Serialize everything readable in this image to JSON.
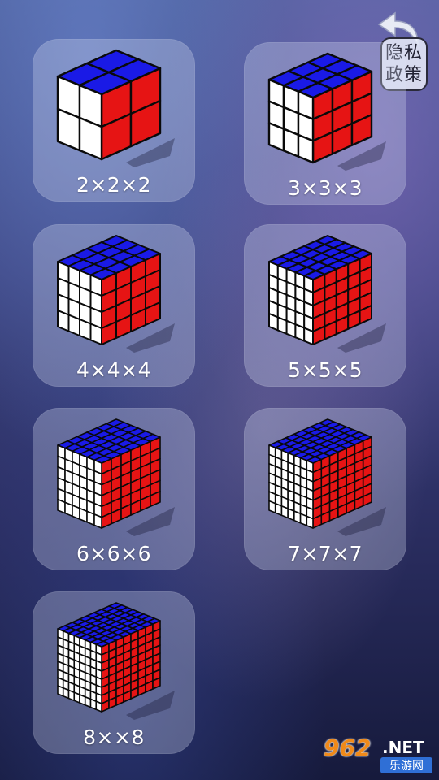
{
  "privacy": {
    "line1": "隐私",
    "line2": "政策",
    "icon": "back-arrow-icon"
  },
  "colors": {
    "top": "#1a1ae6",
    "left": "#ffffff",
    "right": "#e61414",
    "border": "#0a0a0a"
  },
  "puzzles": [
    {
      "label": "2×2×2",
      "n": 2
    },
    {
      "label": "3×3×3",
      "n": 3
    },
    {
      "label": "4×4×4",
      "n": 4
    },
    {
      "label": "5×5×5",
      "n": 5
    },
    {
      "label": "6×6×6",
      "n": 6
    },
    {
      "label": "7×7×7",
      "n": 7
    },
    {
      "label": "8××8",
      "n": 8
    }
  ],
  "watermark": {
    "number": "962",
    "suffix": ".NET",
    "site": "乐游网"
  }
}
